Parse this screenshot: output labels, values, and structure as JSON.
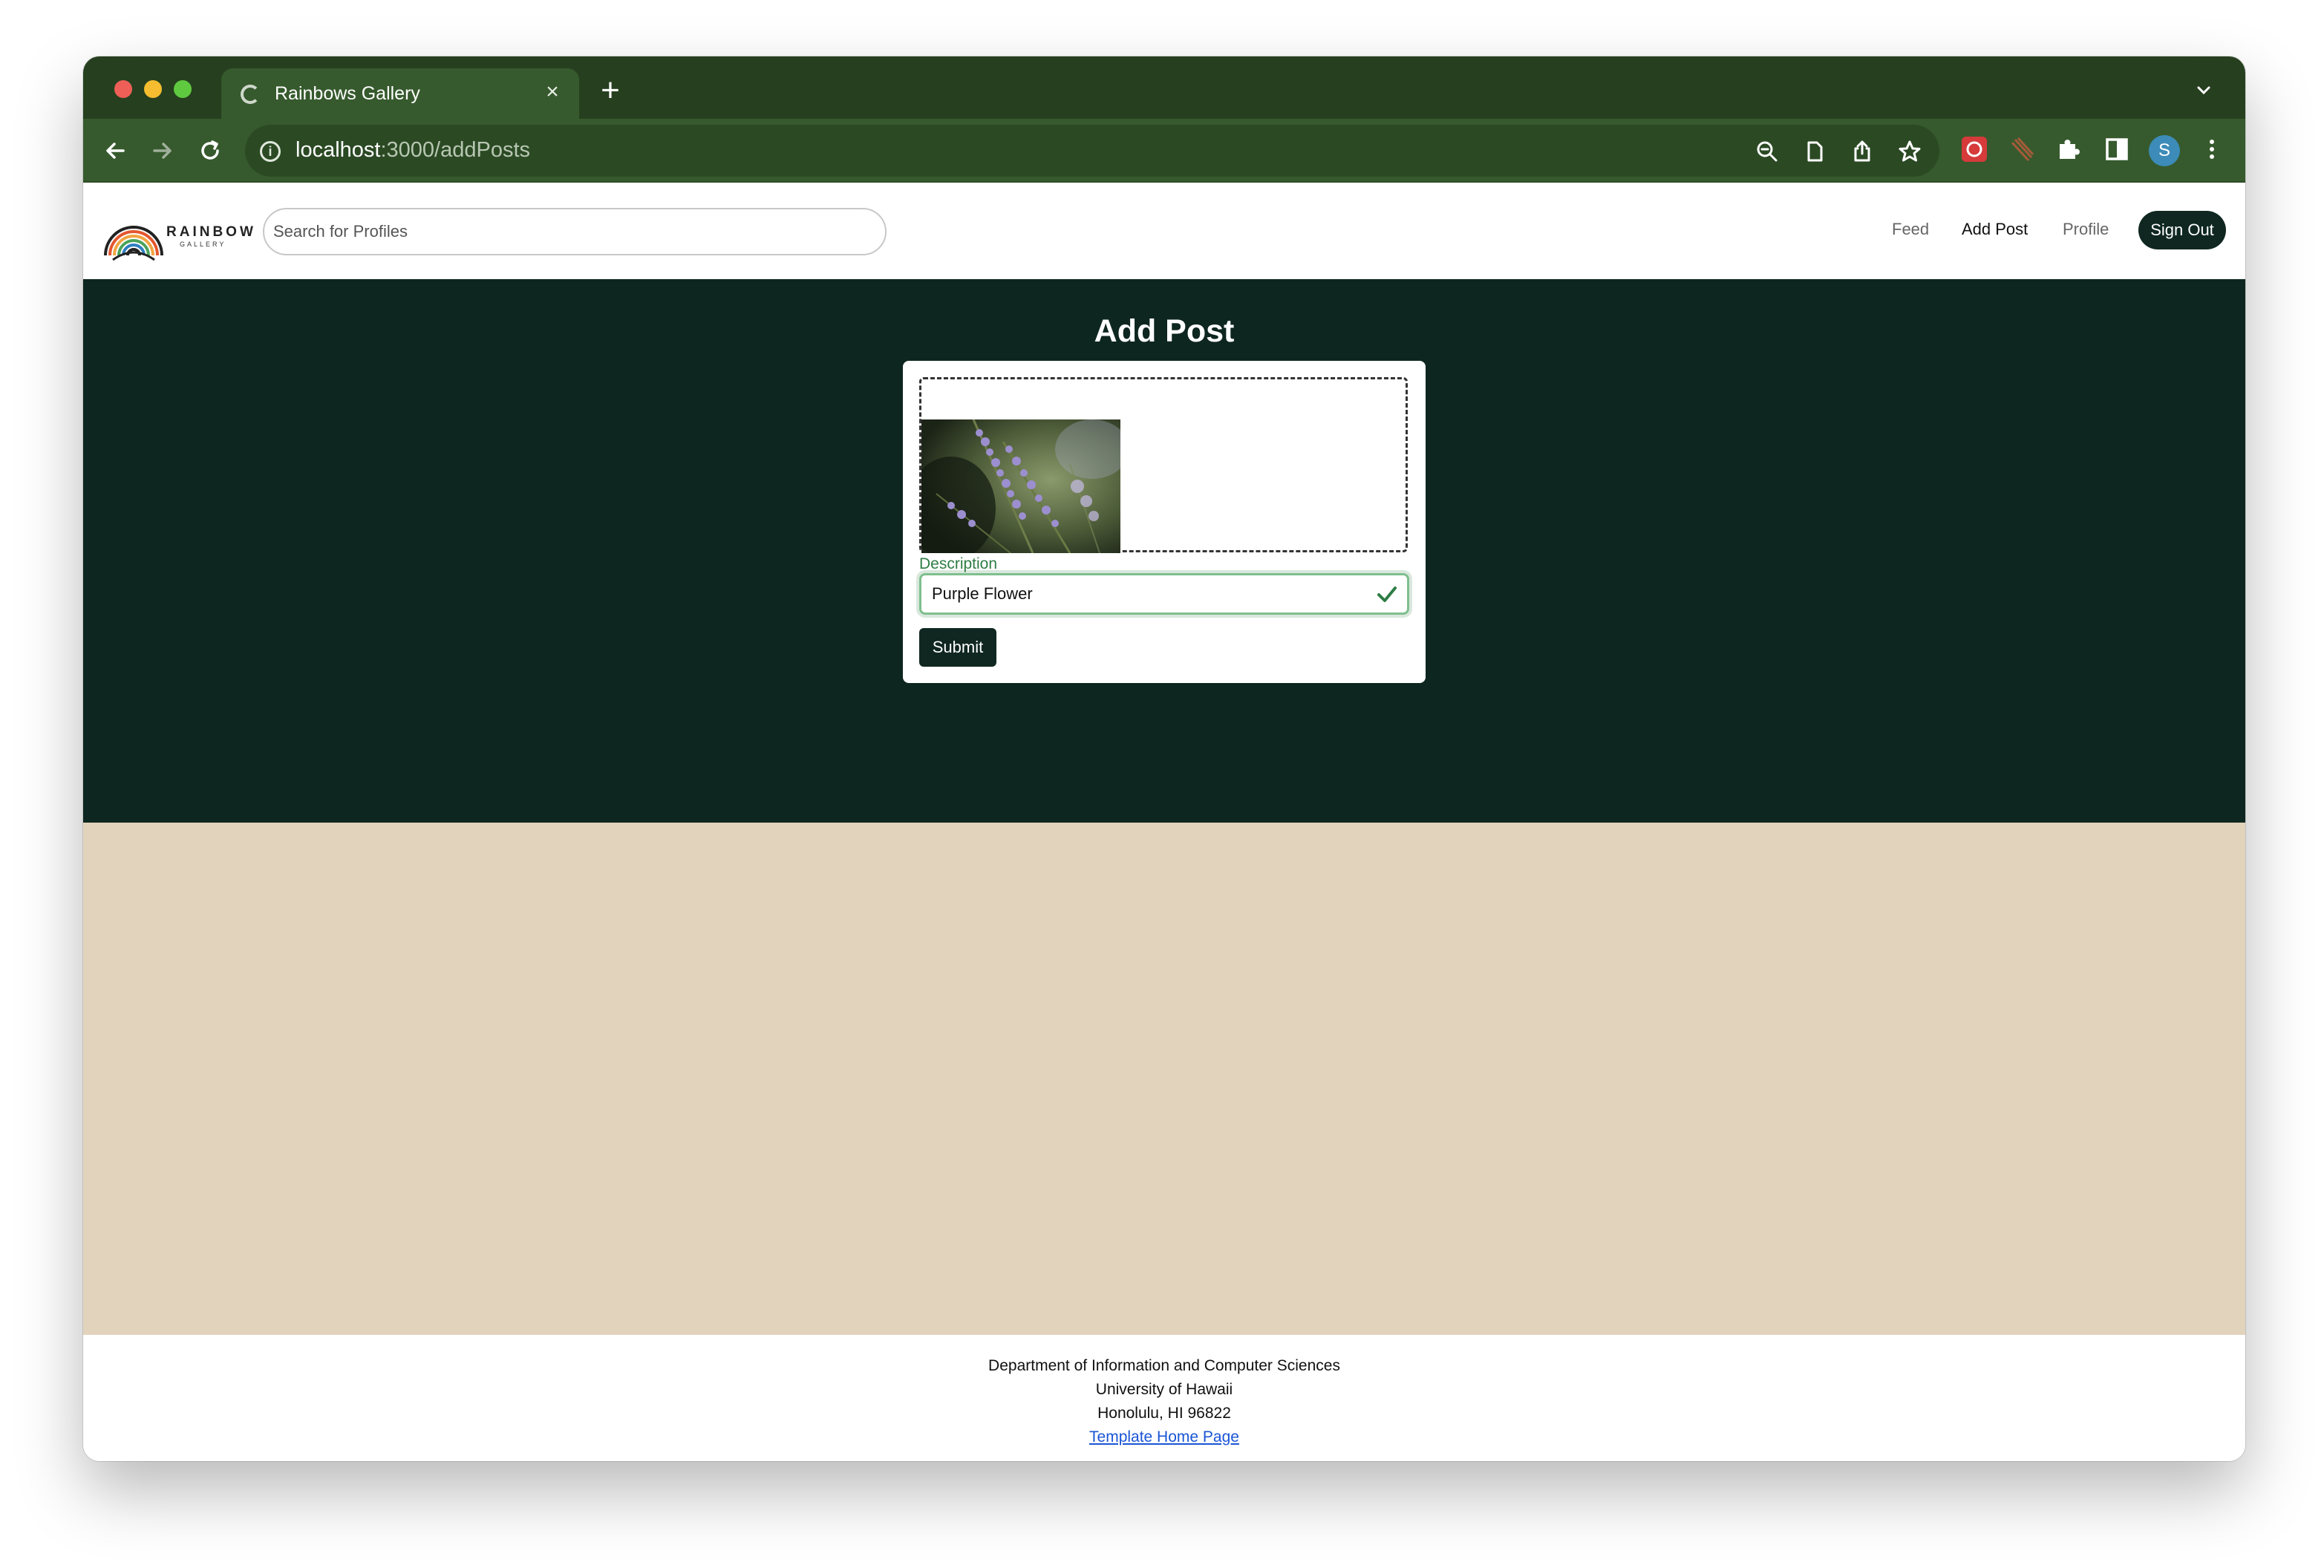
{
  "browser": {
    "tab_title": "Rainbows Gallery",
    "url_host": "localhost",
    "url_path": ":3000/addPosts",
    "profile_initial": "S"
  },
  "navbar": {
    "logo_word": "RAINBOW",
    "logo_sub": "GALLERY",
    "search_placeholder": "Search for Profiles",
    "links": [
      {
        "label": "Feed"
      },
      {
        "label": "Add Post"
      },
      {
        "label": "Profile"
      }
    ],
    "signout_label": "Sign Out"
  },
  "form": {
    "title": "Add Post",
    "description_label": "Description",
    "description_value": "Purple Flower",
    "submit_label": "Submit"
  },
  "footer": {
    "line1": "Department of Information and Computer Sciences",
    "line2": "University of Hawaii",
    "line3": "Honolulu, HI 96822",
    "link": "Template Home Page"
  },
  "colors": {
    "chrome_dark": "#26401f",
    "chrome_mid": "#365a2d",
    "hero_bg": "#0e2620",
    "beige_bg": "#e2d3bd",
    "button_dark": "#0f2720",
    "accent_green": "#2e7d45",
    "link_blue": "#1a55d6"
  }
}
